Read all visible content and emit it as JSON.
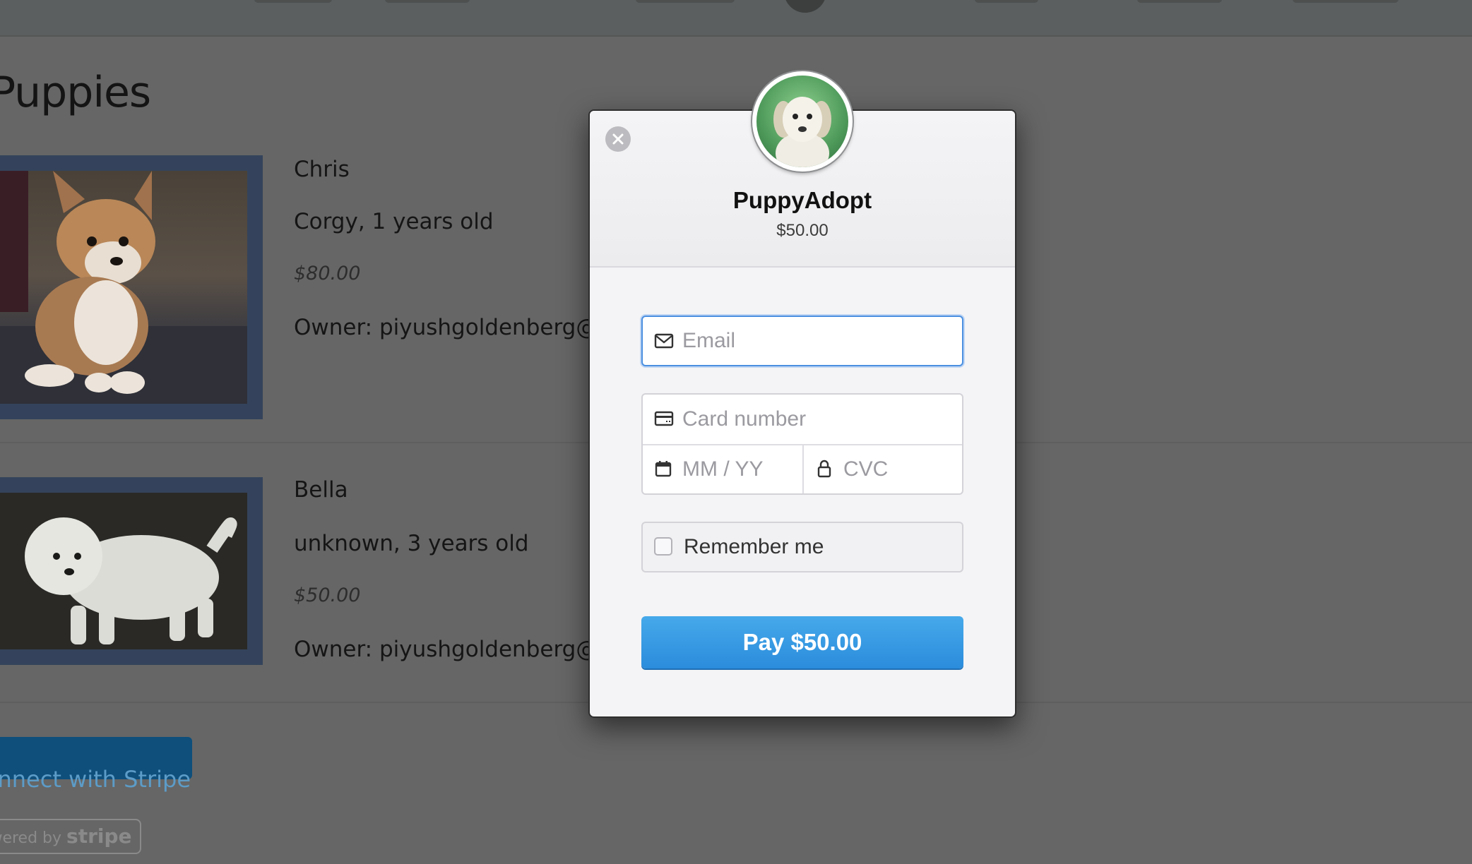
{
  "page": {
    "title": "Puppies",
    "connect_button": "onnect with Stripe",
    "powered_by": {
      "prefix": "owered by",
      "brand": "stripe"
    }
  },
  "listings": [
    {
      "name": "Chris",
      "description": "Corgy, 1 years old",
      "price": "$80.00",
      "owner": "Owner: piyushgoldenberg@"
    },
    {
      "name": "Bella",
      "description": "unknown, 3 years old",
      "price": "$50.00",
      "owner": "Owner: piyushgoldenberg@"
    }
  ],
  "checkout": {
    "merchant": "PuppyAdopt",
    "amount": "$50.00",
    "email_placeholder": "Email",
    "card_number_placeholder": "Card number",
    "expiry_placeholder": "MM / YY",
    "cvc_placeholder": "CVC",
    "remember_label": "Remember me",
    "remember_checked": false,
    "pay_button": "Pay $50.00",
    "colors": {
      "pay_button": "#3a9be4",
      "focus_border": "#4a8fe0"
    },
    "icons": [
      "close-icon",
      "envelope-icon",
      "credit-card-icon",
      "calendar-icon",
      "lock-icon"
    ]
  }
}
